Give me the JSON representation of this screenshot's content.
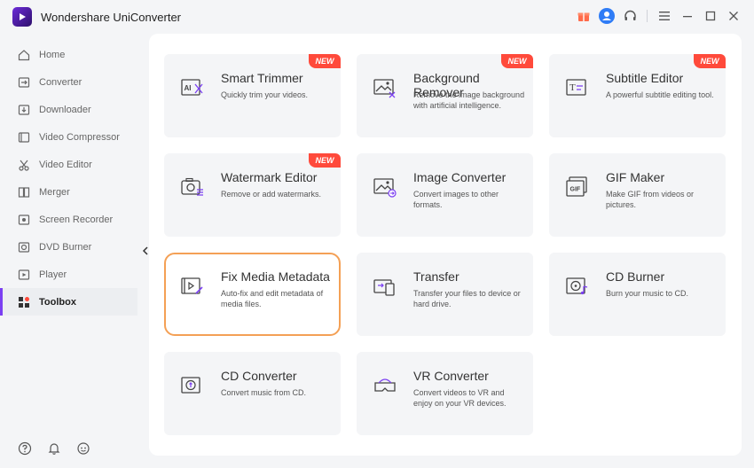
{
  "app": {
    "title": "Wondershare UniConverter"
  },
  "titlebar": {
    "icons": [
      "gift-icon",
      "user-icon",
      "headset-icon",
      "menu-icon",
      "minimize-icon",
      "maximize-icon",
      "close-icon"
    ]
  },
  "sidebar": {
    "items": [
      {
        "label": "Home",
        "icon": "home-icon"
      },
      {
        "label": "Converter",
        "icon": "converter-icon"
      },
      {
        "label": "Downloader",
        "icon": "downloader-icon"
      },
      {
        "label": "Video Compressor",
        "icon": "compressor-icon"
      },
      {
        "label": "Video Editor",
        "icon": "scissors-icon"
      },
      {
        "label": "Merger",
        "icon": "merger-icon"
      },
      {
        "label": "Screen Recorder",
        "icon": "recorder-icon"
      },
      {
        "label": "DVD Burner",
        "icon": "disc-icon"
      },
      {
        "label": "Player",
        "icon": "player-icon"
      },
      {
        "label": "Toolbox",
        "icon": "toolbox-icon",
        "active": true
      }
    ],
    "bottom_icons": [
      "help-icon",
      "bell-icon",
      "feedback-icon"
    ]
  },
  "colors": {
    "accent": "#7b3ff2",
    "badge": "#ff4a3b",
    "selected_border": "#f4a055"
  },
  "tools": [
    {
      "title": "Smart Trimmer",
      "desc": "Quickly trim your videos.",
      "badge": "NEW",
      "icon": "ai-trim-icon"
    },
    {
      "title": "Background Remover",
      "desc": "Remove the image background with artificial intelligence.",
      "badge": "NEW",
      "icon": "image-remove-icon"
    },
    {
      "title": "Subtitle Editor",
      "desc": "A powerful subtitle editing tool.",
      "badge": "NEW",
      "icon": "subtitle-icon"
    },
    {
      "title": "Watermark Editor",
      "desc": "Remove or add watermarks.",
      "badge": "NEW",
      "icon": "watermark-icon"
    },
    {
      "title": "Image Converter",
      "desc": "Convert images to other formats.",
      "badge": "",
      "icon": "image-convert-icon"
    },
    {
      "title": "GIF Maker",
      "desc": "Make GIF from videos or pictures.",
      "badge": "",
      "icon": "gif-icon"
    },
    {
      "title": "Fix Media Metadata",
      "desc": "Auto-fix and edit metadata of media files.",
      "badge": "",
      "icon": "metadata-icon",
      "selected": true
    },
    {
      "title": "Transfer",
      "desc": "Transfer your files to device or hard drive.",
      "badge": "",
      "icon": "transfer-icon"
    },
    {
      "title": "CD Burner",
      "desc": "Burn your music to CD.",
      "badge": "",
      "icon": "cd-burn-icon"
    },
    {
      "title": "CD Converter",
      "desc": "Convert music from CD.",
      "badge": "",
      "icon": "cd-convert-icon"
    },
    {
      "title": "VR Converter",
      "desc": "Convert videos to VR and enjoy on your VR devices.",
      "badge": "",
      "icon": "vr-icon"
    }
  ]
}
